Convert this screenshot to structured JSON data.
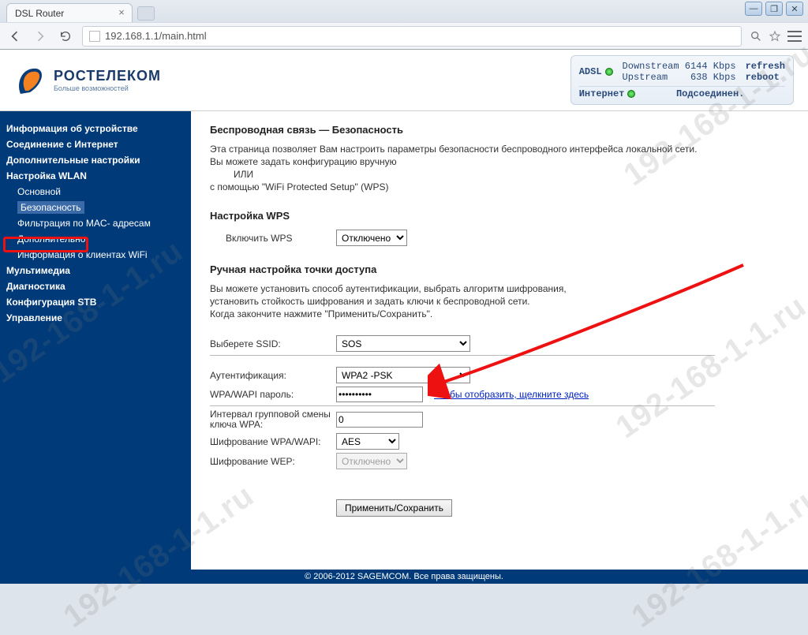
{
  "browser": {
    "tab_title": "DSL Router",
    "url": "192.168.1.1/main.html"
  },
  "logo": {
    "brand": "РОСТЕЛЕКОМ",
    "tagline": "Больше возможностей"
  },
  "status": {
    "adsl_label": "ADSL",
    "downstream_label": "Downstream",
    "downstream_value": "6144 Kbps",
    "upstream_label": "Upstream",
    "upstream_value": "638 Kbps",
    "refresh": "refresh",
    "reboot": "reboot",
    "internet_label": "Интернет",
    "internet_status": "Подсоединен."
  },
  "sidebar": {
    "items": [
      {
        "label": "Информация об устройстве",
        "sub": false,
        "bold": true
      },
      {
        "label": "Соединение с Интернет",
        "sub": false,
        "bold": true
      },
      {
        "label": "Дополнительные настройки",
        "sub": false,
        "bold": true
      },
      {
        "label": "Настройка WLAN",
        "sub": false,
        "bold": true
      },
      {
        "label": "Основной",
        "sub": true,
        "bold": false
      },
      {
        "label": "Безопасность",
        "sub": true,
        "bold": false,
        "selected": true
      },
      {
        "label": "Фильтрация по MAC- адресам",
        "sub": true,
        "bold": false
      },
      {
        "label": "Дополнительно",
        "sub": true,
        "bold": false
      },
      {
        "label": "Информация о клиентах WiFi",
        "sub": true,
        "bold": false
      },
      {
        "label": "Мультимедиа",
        "sub": false,
        "bold": true
      },
      {
        "label": "Диагностика",
        "sub": false,
        "bold": true
      },
      {
        "label": "Конфигурация STB",
        "sub": false,
        "bold": true
      },
      {
        "label": "Управление",
        "sub": false,
        "bold": true
      }
    ]
  },
  "content": {
    "title": "Беспроводная связь — Безопасность",
    "intro1": "Эта страница позволяет Вам настроить параметры безопасности беспроводного интерфейса локальной сети.",
    "intro2": "Вы можете задать конфигурацию вручную",
    "intro_or": "ИЛИ",
    "intro3": "с помощью \"WiFi Protected Setup\" (WPS)",
    "wps_title": "Настройка WPS",
    "wps_enable_label": "Включить WPS",
    "wps_enable_value": "Отключено",
    "manual_title": "Ручная настройка точки доступа",
    "manual_desc1": "Вы можете установить способ аутентификации, выбрать алгоритм шифрования,",
    "manual_desc2": "установить стойкость шифрования и задать ключи к беспроводной сети.",
    "manual_desc3": "Когда закончите нажмите \"Применить/Сохранить\".",
    "ssid_label": "Выберете SSID:",
    "ssid_value": "SOS",
    "auth_label": "Аутентификация:",
    "auth_value": "WPA2 -PSK",
    "pwd_label": "WPA/WAPI пароль:",
    "pwd_value": "••••••••••",
    "pwd_reveal": "Чтобы отобразить, щелкните здесь",
    "rekey_label": "Интервал групповой смены ключа WPA:",
    "rekey_value": "0",
    "enc_label": "Шифрование WPA/WAPI:",
    "enc_value": "AES",
    "wep_label": "Шифрование WEP:",
    "wep_value": "Отключено",
    "save_btn": "Применить/Сохранить"
  },
  "footer": "© 2006-2012 SAGEMCOM. Все права защищены.",
  "watermark": "192-168-1-1.ru"
}
